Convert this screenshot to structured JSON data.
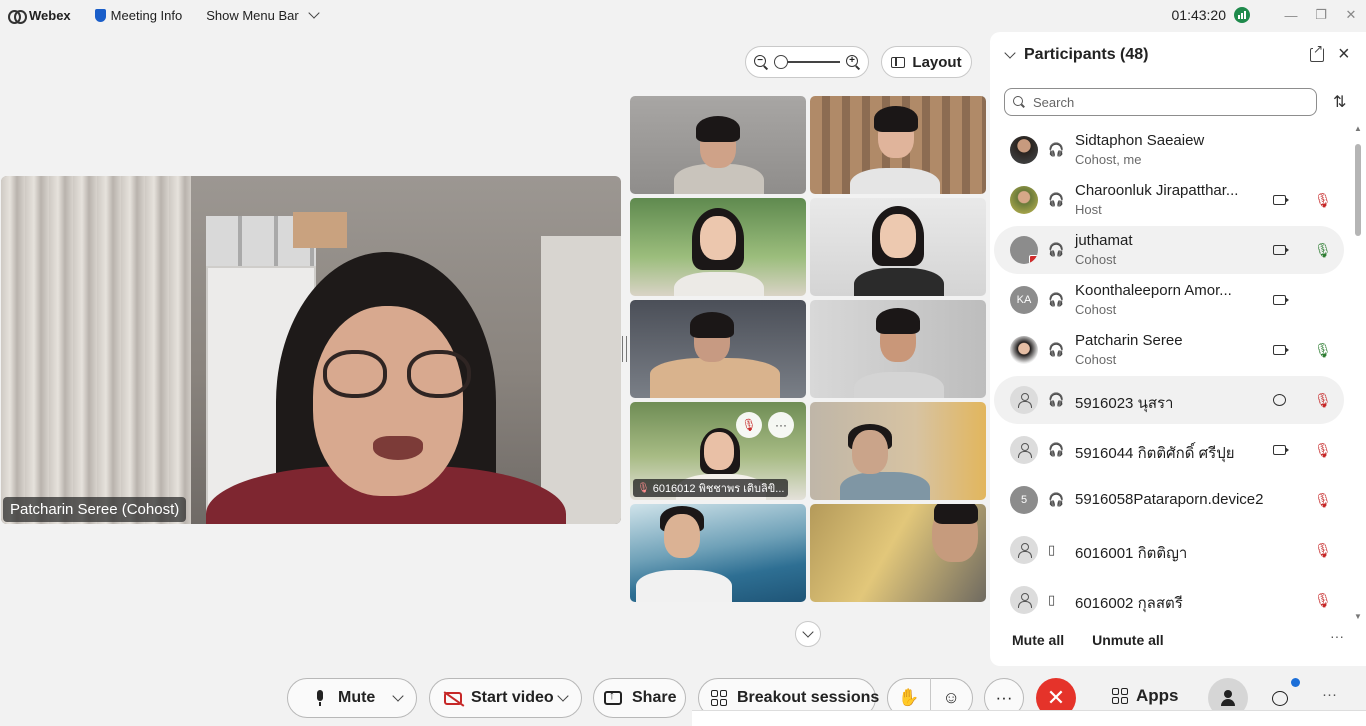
{
  "topbar": {
    "app_name": "Webex",
    "meeting_info": "Meeting Info",
    "show_menu_bar": "Show Menu Bar",
    "clock": "01:43:20"
  },
  "view_controls": {
    "layout_label": "Layout",
    "zoom_out": "−",
    "zoom_in": "+"
  },
  "main_video": {
    "speaker_label": "Patcharin Seree (Cohost)"
  },
  "grid": {
    "labeled_tile_name": "6016012 พิชชาพร เติบลิขิ..."
  },
  "participants": {
    "title": "Participants (48)",
    "search_placeholder": "Search",
    "items": [
      {
        "name": "Sidtaphon Saeaiew",
        "role": "Cohost, me"
      },
      {
        "name": "Charoonluk Jirapatthar...",
        "role": "Host"
      },
      {
        "name": "juthamat",
        "role": "Cohost"
      },
      {
        "name": "Koonthaleeporn Amor...",
        "role": "Cohost",
        "initials": "KA"
      },
      {
        "name": "Patcharin Seree",
        "role": "Cohost"
      },
      {
        "name": "5916023 นุสรา",
        "role": ""
      },
      {
        "name": "5916044 กิตติศักดิ์ ศรีปุย",
        "role": ""
      },
      {
        "name": "5916058Pataraporn.device2",
        "role": "",
        "initials": "5"
      },
      {
        "name": "6016001 กิตติญา",
        "role": ""
      },
      {
        "name": "6016002 กุลสตรี",
        "role": ""
      }
    ],
    "mute_all": "Mute all",
    "unmute_all": "Unmute all"
  },
  "controls": {
    "mute": "Mute",
    "start_video": "Start video",
    "share": "Share",
    "breakout_sessions": "Breakout sessions",
    "apps": "Apps"
  },
  "colors": {
    "end_call": "#e5332a",
    "mic_off": "#c62828",
    "mic_on": "#2e7d32",
    "notification": "#1c6fd8"
  }
}
